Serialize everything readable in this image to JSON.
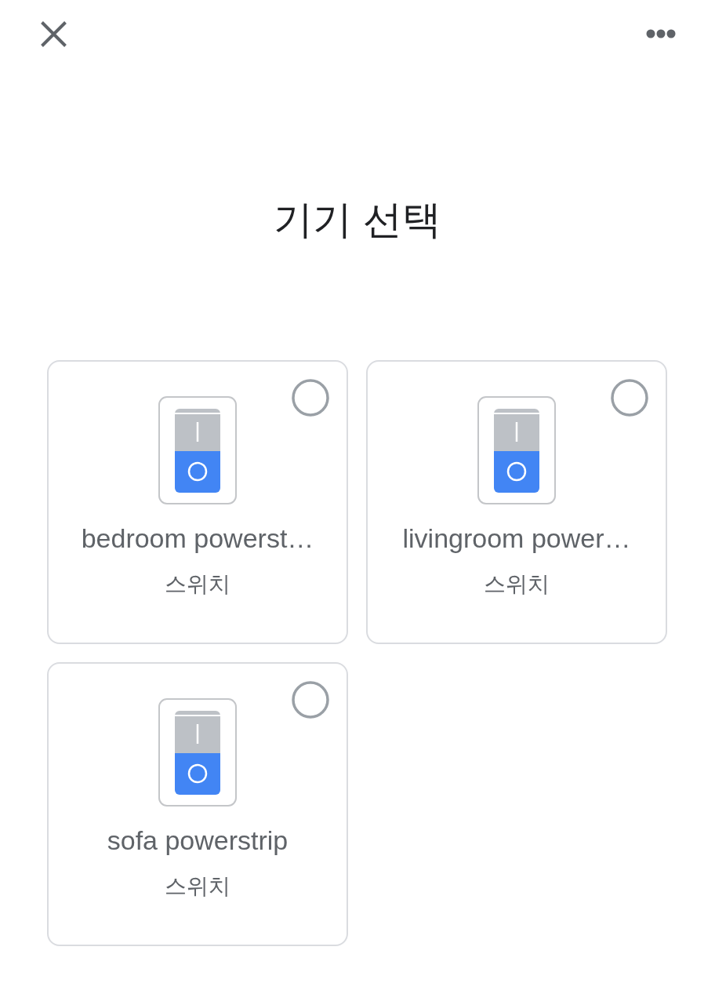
{
  "title": "기기 선택",
  "devices": [
    {
      "name": "bedroom powerst…",
      "type": "스위치",
      "selected": false
    },
    {
      "name": "livingroom power…",
      "type": "스위치",
      "selected": false
    },
    {
      "name": "sofa powerstrip",
      "type": "스위치",
      "selected": false
    }
  ]
}
